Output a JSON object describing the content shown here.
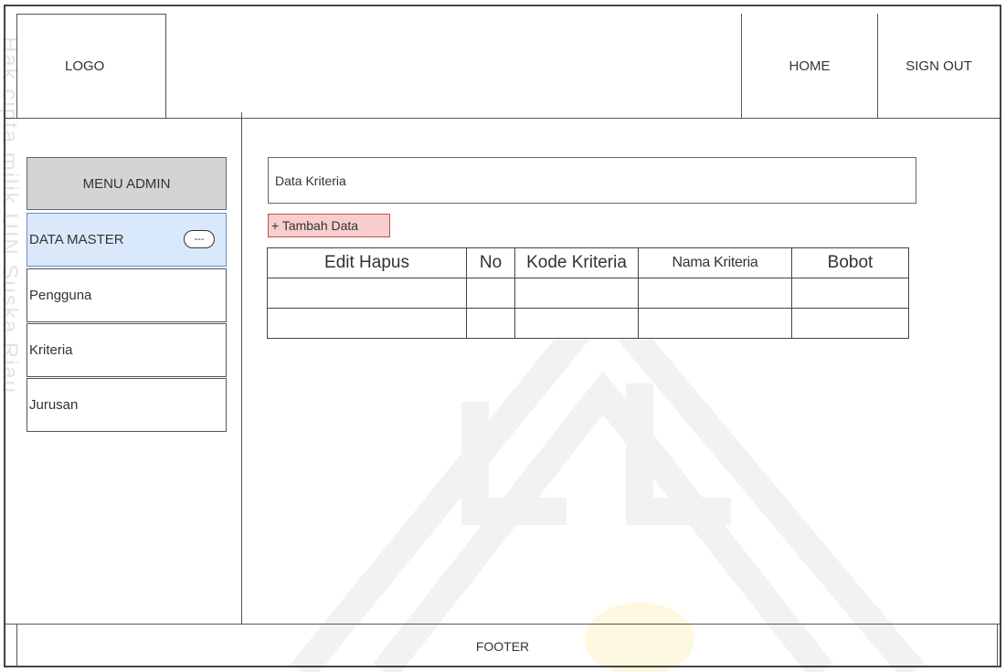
{
  "header": {
    "logo": "LOGO",
    "home": "HOME",
    "sign_out": "SIGN OUT"
  },
  "sidebar": {
    "menu_title": "MENU ADMIN",
    "items": [
      {
        "label": "DATA MASTER",
        "badge": "---"
      },
      {
        "label": "Pengguna"
      },
      {
        "label": "Kriteria"
      },
      {
        "label": "Jurusan"
      }
    ]
  },
  "main": {
    "title": "Data Kriteria",
    "add_button": "+ Tambah Data",
    "table": {
      "columns": [
        "Edit Hapus",
        "No",
        "Kode Kriteria",
        "Nama Kriteria",
        "Bobot"
      ]
    }
  },
  "footer": {
    "label": "FOOTER"
  },
  "colors": {
    "menu_bg": "#d4d4d4",
    "active_item_bg": "#dae8fc",
    "add_button_bg": "#f8cecc"
  }
}
